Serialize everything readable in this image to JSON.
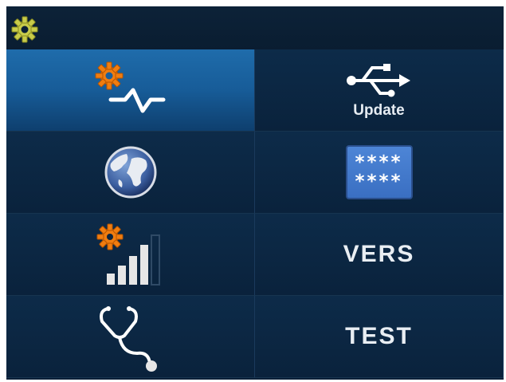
{
  "header": {
    "settings_icon": "gear-icon"
  },
  "menu": [
    {
      "id": "sensor-settings",
      "icon": "gear-signal-icon",
      "label": "",
      "selected": true
    },
    {
      "id": "update",
      "icon": "usb-icon",
      "label": "Update",
      "selected": false
    },
    {
      "id": "network",
      "icon": "globe-icon",
      "label": "",
      "selected": false
    },
    {
      "id": "password",
      "icon": "password-icon",
      "label": "",
      "password_rows": [
        "****",
        "****"
      ],
      "selected": false
    },
    {
      "id": "signal-settings",
      "icon": "gear-signal-bars-icon",
      "label": "",
      "selected": false
    },
    {
      "id": "version",
      "icon": "",
      "label": "VERS",
      "selected": false
    },
    {
      "id": "diagnostics",
      "icon": "stethoscope-icon",
      "label": "",
      "selected": false
    },
    {
      "id": "test",
      "icon": "",
      "label": "TEST",
      "selected": false
    }
  ],
  "colors": {
    "background": "#0a2038",
    "selected": "#1f6cab",
    "gear_header": "#c8cc4a",
    "gear_orange": "#f07d10"
  }
}
